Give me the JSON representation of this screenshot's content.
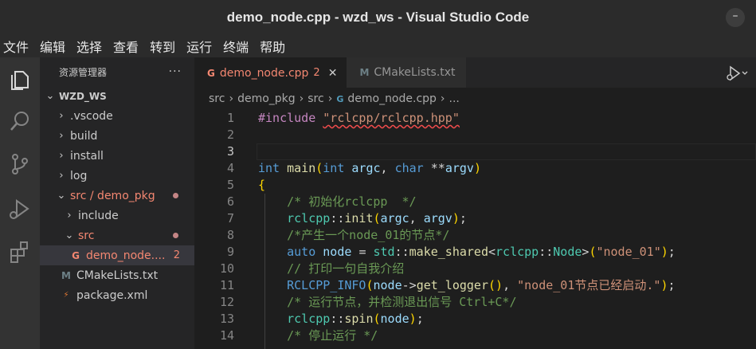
{
  "window": {
    "title": "demo_node.cpp - wzd_ws - Visual Studio Code",
    "minimize": "–"
  },
  "menu": [
    "文件",
    "编辑",
    "选择",
    "查看",
    "转到",
    "运行",
    "终端",
    "帮助"
  ],
  "activity": [
    "explorer-icon",
    "search-icon",
    "source-control-icon",
    "run-debug-icon",
    "extensions-icon"
  ],
  "sidebar": {
    "title": "资源管理器",
    "more": "···",
    "workspace": "WZD_WS",
    "items": [
      {
        "label": ".vscode",
        "chevron": "›"
      },
      {
        "label": "build",
        "chevron": "›"
      },
      {
        "label": "install",
        "chevron": "›"
      },
      {
        "label": "log",
        "chevron": "›"
      },
      {
        "label": "src / demo_pkg",
        "chevron": "⌄"
      },
      {
        "label": "include",
        "chevron": "›"
      },
      {
        "label": "src",
        "chevron": "⌄"
      },
      {
        "label": "demo_node....",
        "icon": "G",
        "badge": "2"
      },
      {
        "label": "CMakeLists.txt",
        "icon": "M"
      },
      {
        "label": "package.xml",
        "icon": "⚡"
      }
    ]
  },
  "tabs": [
    {
      "label": "demo_node.cpp",
      "icon": "G",
      "problems": "2",
      "close": "✕"
    },
    {
      "label": "CMakeLists.txt",
      "icon": "M"
    }
  ],
  "breadcrumb": {
    "items": [
      "src",
      "demo_pkg",
      "src",
      "demo_node.cpp",
      "..."
    ],
    "separator": "›",
    "file_icon": "G"
  },
  "editor": {
    "line_numbers": [
      "1",
      "2",
      "3",
      "4",
      "5",
      "6",
      "7",
      "8",
      "9",
      "10",
      "11",
      "12",
      "13",
      "14"
    ],
    "lines": [
      "#include \"rclcpp/rclcpp.hpp\"",
      "",
      "",
      "int main(int argc, char **argv)",
      "{",
      "    /* 初始化rclcpp  */",
      "    rclcpp::init(argc, argv);",
      "    /*产生一个node_01的节点*/",
      "    auto node = std::make_shared<rclcpp::Node>(\"node_01\");",
      "    // 打印一句自我介绍",
      "    RCLCPP_INFO(node->get_logger(), \"node_01节点已经启动.\");",
      "    /* 运行节点，并检测退出信号 Ctrl+C*/",
      "    rclcpp::spin(node);",
      "    /* 停止运行 */"
    ]
  },
  "colors": {
    "keyword": "#569cd6",
    "preprocessor": "#c586c0",
    "string": "#ce9178",
    "function": "#dcdcaa",
    "variable": "#9cdcfe",
    "namespace": "#4ec9b0",
    "comment": "#6a9955",
    "error": "#f48771"
  }
}
